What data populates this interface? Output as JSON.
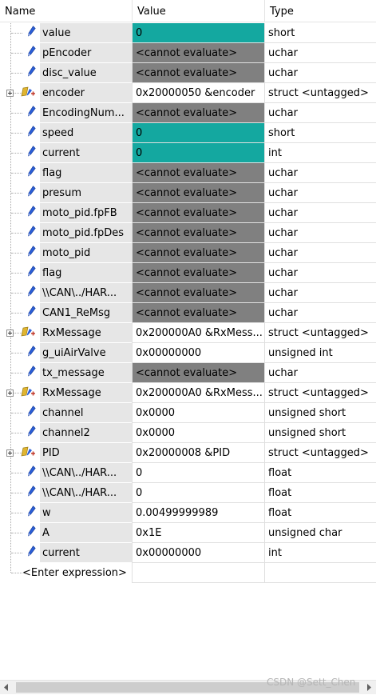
{
  "header": {
    "name": "Name",
    "value": "Value",
    "type": "Type"
  },
  "rows": [
    {
      "name": "value",
      "value": "0",
      "type": "short",
      "icon": "variable-icon",
      "state": "changed"
    },
    {
      "name": "pEncoder",
      "value": "<cannot evaluate>",
      "type": "uchar",
      "icon": "variable-icon",
      "state": "cannot"
    },
    {
      "name": "disc_value",
      "value": "<cannot evaluate>",
      "type": "uchar",
      "icon": "variable-icon",
      "state": "cannot"
    },
    {
      "name": "encoder",
      "value": "0x20000050 &encoder",
      "type": "struct <untagged>",
      "icon": "struct-icon",
      "state": "normal",
      "expandable": true
    },
    {
      "name": "EncodingNum...",
      "value": "<cannot evaluate>",
      "type": "uchar",
      "icon": "variable-icon",
      "state": "cannot"
    },
    {
      "name": "speed",
      "value": "0",
      "type": "short",
      "icon": "variable-icon",
      "state": "changed"
    },
    {
      "name": "current",
      "value": "0",
      "type": "int",
      "icon": "variable-icon",
      "state": "changed"
    },
    {
      "name": "flag",
      "value": "<cannot evaluate>",
      "type": "uchar",
      "icon": "variable-icon",
      "state": "cannot"
    },
    {
      "name": "presum",
      "value": "<cannot evaluate>",
      "type": "uchar",
      "icon": "variable-icon",
      "state": "cannot"
    },
    {
      "name": "moto_pid.fpFB",
      "value": "<cannot evaluate>",
      "type": "uchar",
      "icon": "variable-icon",
      "state": "cannot"
    },
    {
      "name": "moto_pid.fpDes",
      "value": "<cannot evaluate>",
      "type": "uchar",
      "icon": "variable-icon",
      "state": "cannot"
    },
    {
      "name": "moto_pid",
      "value": "<cannot evaluate>",
      "type": "uchar",
      "icon": "variable-icon",
      "state": "cannot"
    },
    {
      "name": "flag",
      "value": "<cannot evaluate>",
      "type": "uchar",
      "icon": "variable-icon",
      "state": "cannot"
    },
    {
      "name": "\\\\CAN\\../HAR...",
      "value": "<cannot evaluate>",
      "type": "uchar",
      "icon": "variable-icon",
      "state": "cannot"
    },
    {
      "name": "CAN1_ReMsg",
      "value": "<cannot evaluate>",
      "type": "uchar",
      "icon": "variable-icon",
      "state": "cannot"
    },
    {
      "name": "RxMessage",
      "value": "0x200000A0 &RxMess...",
      "type": "struct <untagged>",
      "icon": "struct-icon",
      "state": "normal",
      "expandable": true
    },
    {
      "name": "g_uiAirValve",
      "value": "0x00000000",
      "type": "unsigned int",
      "icon": "variable-icon",
      "state": "normal"
    },
    {
      "name": "tx_message",
      "value": "<cannot evaluate>",
      "type": "uchar",
      "icon": "variable-icon",
      "state": "cannot"
    },
    {
      "name": "RxMessage",
      "value": "0x200000A0 &RxMess...",
      "type": "struct <untagged>",
      "icon": "struct-icon",
      "state": "normal",
      "expandable": true
    },
    {
      "name": "channel",
      "value": "0x0000",
      "type": "unsigned short",
      "icon": "variable-icon",
      "state": "normal"
    },
    {
      "name": "channel2",
      "value": "0x0000",
      "type": "unsigned short",
      "icon": "variable-icon",
      "state": "normal"
    },
    {
      "name": "PID",
      "value": "0x20000008 &PID",
      "type": "struct <untagged>",
      "icon": "struct-icon",
      "state": "normal",
      "expandable": true
    },
    {
      "name": "\\\\CAN\\../HAR...",
      "value": "0",
      "type": "float",
      "icon": "variable-icon",
      "state": "normal"
    },
    {
      "name": "\\\\CAN\\../HAR...",
      "value": "0",
      "type": "float",
      "icon": "variable-icon",
      "state": "normal"
    },
    {
      "name": "w",
      "value": "0.00499999989",
      "type": "float",
      "icon": "variable-icon",
      "state": "normal"
    },
    {
      "name": "A",
      "value": "0x1E",
      "type": "unsigned char",
      "icon": "variable-icon",
      "state": "normal"
    },
    {
      "name": "current",
      "value": "0x00000000",
      "type": "int",
      "icon": "variable-icon",
      "state": "normal"
    }
  ],
  "enter_expression": "<Enter expression>",
  "watermark": "CSDN @Sett_Chen",
  "colors": {
    "cannot_evaluate_bg": "#808080",
    "changed_value_bg": "#14a8a0",
    "name_cell_bg": "#e6e6e6",
    "variable_icon": "#2b5fd9",
    "struct_icon": "#e0b531"
  }
}
